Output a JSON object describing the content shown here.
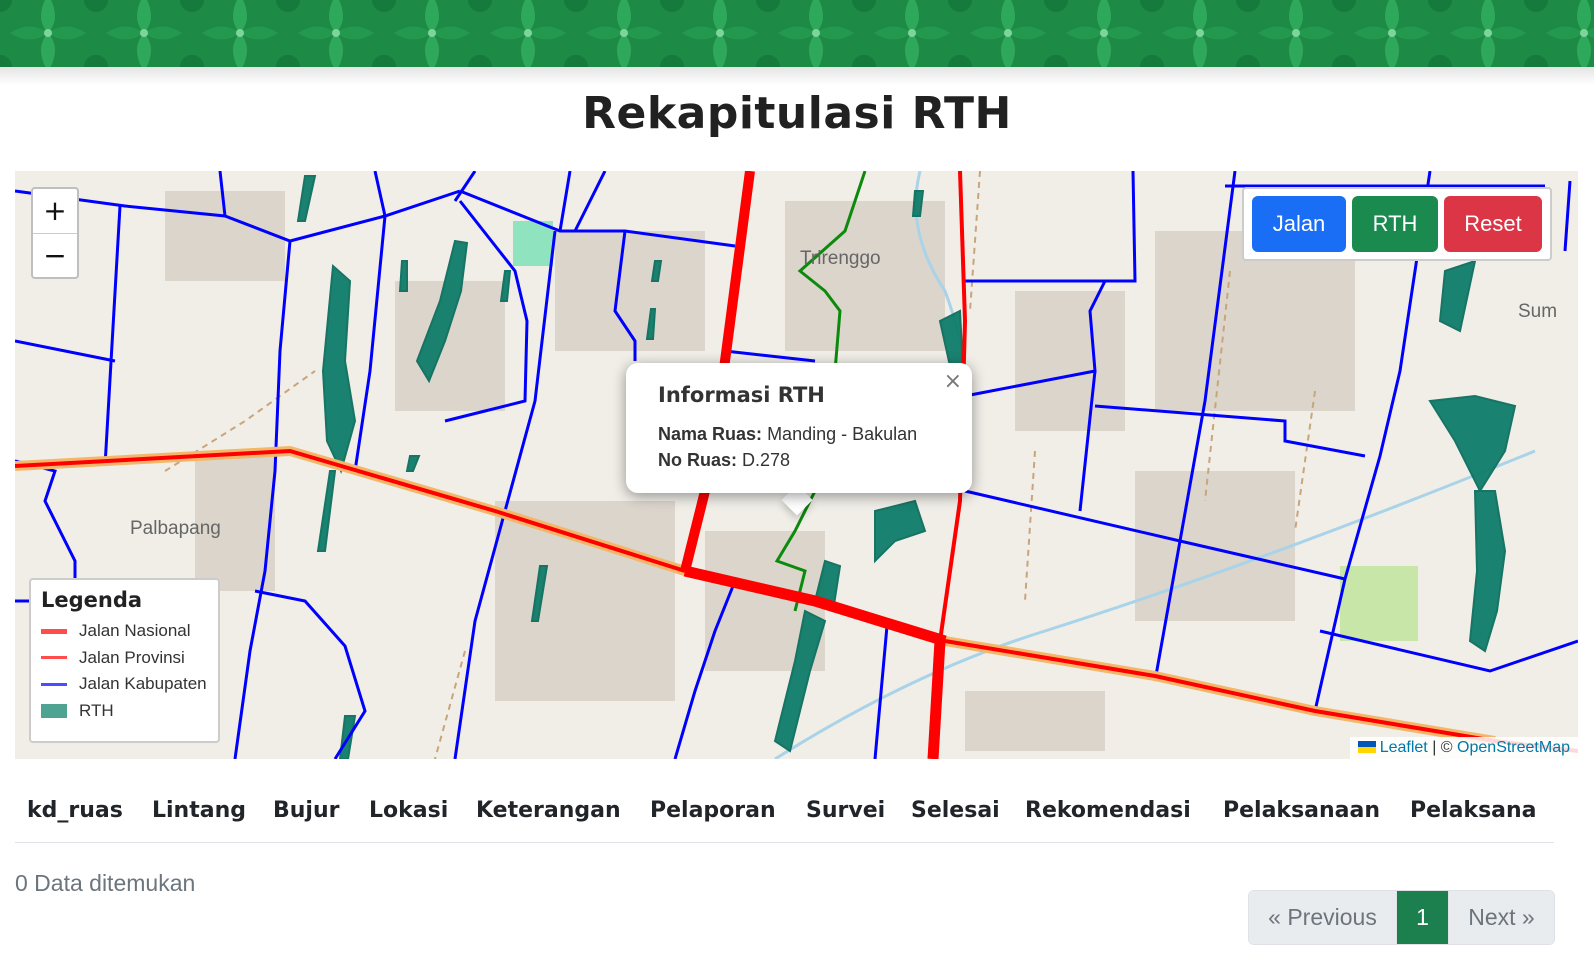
{
  "page": {
    "title": "Rekapitulasi RTH"
  },
  "map": {
    "zoom_in": "+",
    "zoom_out": "−",
    "layer_buttons": [
      {
        "label": "Jalan",
        "color": "#1a6ef6"
      },
      {
        "label": "RTH",
        "color": "#1b8a4f"
      },
      {
        "label": "Reset",
        "color": "#dc3545"
      }
    ],
    "labels": [
      "Trirenggo",
      "Palbapang",
      "Sum"
    ],
    "popup": {
      "title": "Informasi RTH",
      "close": "×",
      "rows": [
        {
          "key": "Nama Ruas:",
          "value": "Manding - Bakulan"
        },
        {
          "key": "No Ruas:",
          "value": "D.278"
        }
      ]
    },
    "legend": {
      "title": "Legenda",
      "items": [
        {
          "label": "Jalan Nasional",
          "color": "#ff0000"
        },
        {
          "label": "Jalan Provinsi",
          "color": "#ff0000"
        },
        {
          "label": "Jalan Kabupaten",
          "color": "#0000ff"
        },
        {
          "label": "RTH",
          "color": "#0d7b6a"
        }
      ]
    },
    "attribution": {
      "leaflet": "Leaflet",
      "separator": "| ©",
      "osm": "OpenStreetMap"
    }
  },
  "table": {
    "columns": [
      "kd_ruas",
      "Lintang",
      "Bujur",
      "Lokasi",
      "Keterangan",
      "Pelaporan",
      "Survei",
      "Selesai",
      "Rekomendasi",
      "Pelaksanaan",
      "Pelaksana"
    ],
    "count_text": "0 Data ditemukan"
  },
  "pagination": {
    "previous": "« Previous",
    "current": "1",
    "next": "Next »"
  }
}
